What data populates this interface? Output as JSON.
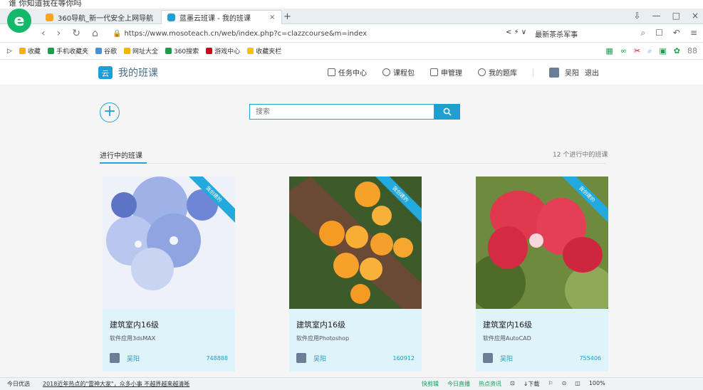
{
  "doc_caption": "谁 你知道我在等你吗",
  "browser": {
    "tabs": [
      {
        "label": "360导航_新一代安全上网导航",
        "active": false,
        "color": "#f5a623"
      },
      {
        "label": "蓝墨云班课 - 我的班课",
        "active": true,
        "color": "#1e9fd8"
      }
    ],
    "tab_close": "×",
    "new_tab": "+",
    "window_controls": [
      "⇩",
      "—",
      "□",
      "×"
    ],
    "nav": [
      "‹",
      "›",
      "↻",
      "⌂"
    ],
    "url": "https://www.mosoteach.cn/web/index.php?c=clazzcourse&m=index",
    "addr_right": [
      "< ⚡ ∨",
      "最新茶杀军事"
    ],
    "addr_tools": [
      "⌕",
      "☐",
      "↶",
      "≡"
    ],
    "favorites": [
      {
        "label": "收藏",
        "color": "#f5b400"
      },
      {
        "label": "手机收藏夹",
        "color": "#1c9e4b"
      },
      {
        "label": "谷歌",
        "color": "#4a90d9"
      },
      {
        "label": "网址大全",
        "color": "#f5b400"
      },
      {
        "label": "360搜索",
        "color": "#1c9e4b"
      },
      {
        "label": "游戏中心",
        "color": "#d0021b"
      },
      {
        "label": "收藏夹栏",
        "color": "#f5c400"
      }
    ],
    "fav_tools": [
      "▦",
      "∞",
      "✂",
      "⌕",
      "▣",
      "✿",
      "88"
    ]
  },
  "header": {
    "logo_text": "云",
    "title": "我的班课",
    "menu": [
      "任务中心",
      "课程包",
      "申管理",
      "我的题库"
    ],
    "user_name": "吴阳",
    "logout": "退出"
  },
  "toolbar": {
    "add_label": "+",
    "search_placeholder": "搜索",
    "search_icon": "search-icon"
  },
  "section": {
    "title": "进行中的班课",
    "count": "12 个进行中的班课"
  },
  "courses": [
    {
      "ribbon": "我创建的",
      "title": "建筑室内16级",
      "subtitle": "软件应用3dsMAX",
      "teacher": "吴阳",
      "code": "748888"
    },
    {
      "ribbon": "我创建的",
      "title": "建筑室内16级",
      "subtitle": "软件应用Photoshop",
      "teacher": "吴阳",
      "code": "160912"
    },
    {
      "ribbon": "我创建的",
      "title": "建筑室内16级",
      "subtitle": "软件应用AutoCAD",
      "teacher": "吴阳",
      "code": "755406"
    }
  ],
  "statusbar": {
    "left": "今日优选",
    "news": "2018近年热点的\"雷神大家\"，众多小事 不越界越来越清晰",
    "right": [
      "快剪辑",
      "今日直播",
      "热点资讯",
      "⊡",
      "↓下载",
      "⚐",
      "⊙",
      "◫",
      "100%"
    ]
  }
}
